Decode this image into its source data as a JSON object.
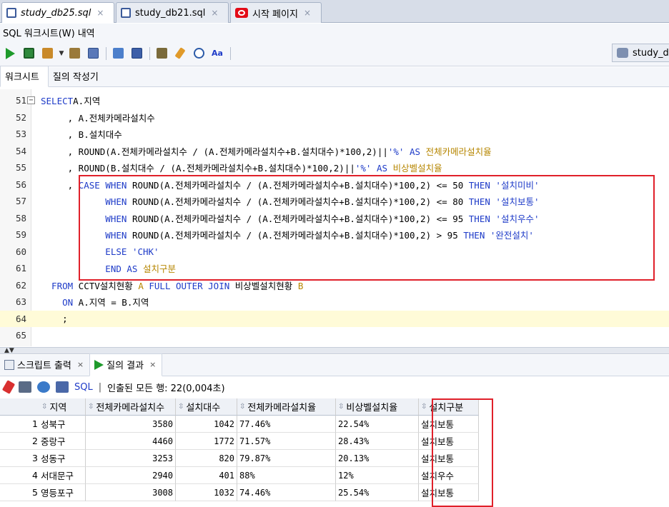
{
  "doc_tabs": [
    {
      "label": "study_db25.sql",
      "close": "×",
      "active": true
    },
    {
      "label": "study_db21.sql",
      "close": "×",
      "active": false
    },
    {
      "label": "시작 페이지",
      "close": "×",
      "active": false
    }
  ],
  "sub_tabs": {
    "worksheet": "SQL 워크시트(W)",
    "history": "내역"
  },
  "connection": {
    "label": "study_d"
  },
  "editor_tabs": {
    "worksheet": "워크시트",
    "query_builder": "질의 작성기"
  },
  "editor": {
    "lines": [
      {
        "n": "51",
        "fold": "−",
        "parts": [
          [
            "kw",
            "SELECT"
          ],
          [
            "",
            "A.지역"
          ]
        ]
      },
      {
        "n": "52",
        "parts": [
          [
            "",
            "     , A.전체카메라설치수"
          ]
        ]
      },
      {
        "n": "53",
        "parts": [
          [
            "",
            "     , B.설치대수"
          ]
        ]
      },
      {
        "n": "54",
        "parts": [
          [
            "",
            "     , ROUND(A.전체카메라설치수 / (A.전체카메라설치수+B.설치대수)*100,2)||"
          ],
          [
            "str",
            "'%'"
          ],
          [
            "kw",
            " AS "
          ],
          [
            "al",
            "전체카메라설치율"
          ]
        ]
      },
      {
        "n": "55",
        "parts": [
          [
            "",
            "     , ROUND(B.설치대수 / (A.전체카메라설치수+B.설치대수)*100,2)||"
          ],
          [
            "str",
            "'%'"
          ],
          [
            "kw",
            " AS "
          ],
          [
            "al",
            "비상벨설치율"
          ]
        ]
      },
      {
        "n": "56",
        "parts": [
          [
            "",
            "     , "
          ],
          [
            "kw",
            "CASE WHEN"
          ],
          [
            "",
            " ROUND(A.전체카메라설치수 / (A.전체카메라설치수+B.설치대수)*100,2) <= 50 "
          ],
          [
            "kw",
            "THEN"
          ],
          [
            "str",
            " '설치미비'"
          ]
        ]
      },
      {
        "n": "57",
        "parts": [
          [
            "kw",
            "            WHEN"
          ],
          [
            "",
            " ROUND(A.전체카메라설치수 / (A.전체카메라설치수+B.설치대수)*100,2) <= 80 "
          ],
          [
            "kw",
            "THEN"
          ],
          [
            "str",
            " '설치보통'"
          ]
        ]
      },
      {
        "n": "58",
        "parts": [
          [
            "kw",
            "            WHEN"
          ],
          [
            "",
            " ROUND(A.전체카메라설치수 / (A.전체카메라설치수+B.설치대수)*100,2) <= 95 "
          ],
          [
            "kw",
            "THEN"
          ],
          [
            "str",
            " '설치우수'"
          ]
        ]
      },
      {
        "n": "59",
        "parts": [
          [
            "kw",
            "            WHEN"
          ],
          [
            "",
            " ROUND(A.전체카메라설치수 / (A.전체카메라설치수+B.설치대수)*100,2) > 95 "
          ],
          [
            "kw",
            "THEN"
          ],
          [
            "str",
            " '완전설치'"
          ]
        ]
      },
      {
        "n": "60",
        "parts": [
          [
            "kw",
            "            ELSE"
          ],
          [
            "str",
            " 'CHK'"
          ]
        ]
      },
      {
        "n": "61",
        "parts": [
          [
            "kw",
            "            END AS"
          ],
          [
            "al",
            " 설치구분"
          ]
        ]
      },
      {
        "n": "62",
        "parts": [
          [
            "kw",
            "  FROM"
          ],
          [
            "",
            " CCTV설치현황 "
          ],
          [
            "al",
            "A"
          ],
          [
            "kw",
            " FULL OUTER JOIN"
          ],
          [
            "",
            " 비상벨설치현황 "
          ],
          [
            "al",
            "B"
          ]
        ]
      },
      {
        "n": "63",
        "parts": [
          [
            "kw",
            "    ON"
          ],
          [
            "",
            " A.지역 = B.지역"
          ]
        ]
      },
      {
        "n": "64",
        "parts": [
          [
            "",
            "    ;"
          ]
        ]
      },
      {
        "n": "65",
        "parts": [
          [
            "",
            ""
          ]
        ]
      }
    ]
  },
  "result_tabs": [
    {
      "label": "스크립트 출력",
      "close": "×"
    },
    {
      "label": "질의 결과",
      "close": "×"
    }
  ],
  "result_toolbar": {
    "sql_label": "SQL",
    "sep": "|",
    "status": "인출된 모든 행: 22(0,004초)"
  },
  "grid": {
    "sort_glyph": "⇳",
    "columns": [
      "지역",
      "전체카메라설치수",
      "설치대수",
      "전체카메라설치율",
      "비상벨설치율",
      "설치구분"
    ],
    "rows": [
      {
        "n": "1",
        "cells": [
          "성북구",
          "3580",
          "1042",
          "77.46%",
          "22.54%",
          "설치보통"
        ]
      },
      {
        "n": "2",
        "cells": [
          "중랑구",
          "4460",
          "1772",
          "71.57%",
          "28.43%",
          "설치보통"
        ]
      },
      {
        "n": "3",
        "cells": [
          "성동구",
          "3253",
          "820",
          "79.87%",
          "20.13%",
          "설치보통"
        ]
      },
      {
        "n": "4",
        "cells": [
          "서대문구",
          "2940",
          "401",
          "88%",
          "12%",
          "설치우수"
        ]
      },
      {
        "n": "5",
        "cells": [
          "영등포구",
          "3008",
          "1032",
          "74.46%",
          "25.54%",
          "설치보통"
        ]
      }
    ]
  },
  "colors": {
    "highlight": "#e0202a",
    "keyword": "#1e3bc8",
    "alias": "#b68600"
  }
}
